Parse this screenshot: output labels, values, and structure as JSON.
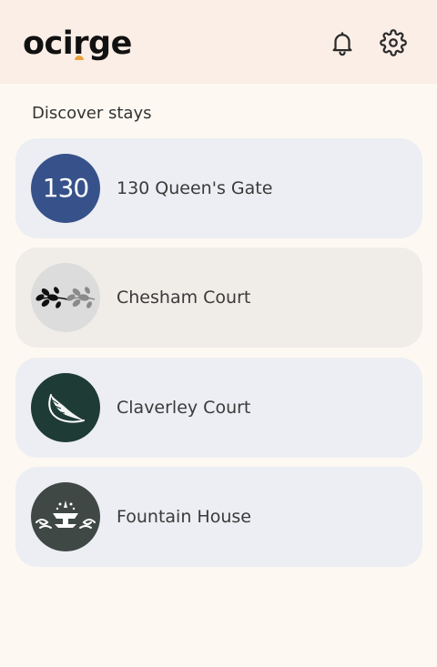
{
  "app": {
    "logo_text_before": "oci",
    "logo_text_after": "rge",
    "logo_accent_color": "#e8a33d"
  },
  "header": {
    "notifications_icon": "bell-icon",
    "settings_icon": "gear-icon"
  },
  "main": {
    "section_title": "Discover stays",
    "stays": [
      {
        "name": "130 Queen's Gate",
        "avatar_text": "130",
        "avatar_color": "#37528a",
        "card_color": "#eceef3"
      },
      {
        "name": "Chesham Court",
        "avatar_color": "#dcdcdc",
        "card_color": "#f0ece8"
      },
      {
        "name": "Claverley Court",
        "avatar_color": "#1f3b36",
        "card_color": "#eceef3"
      },
      {
        "name": "Fountain House",
        "avatar_color": "#3f4844",
        "card_color": "#eceef3"
      }
    ]
  }
}
